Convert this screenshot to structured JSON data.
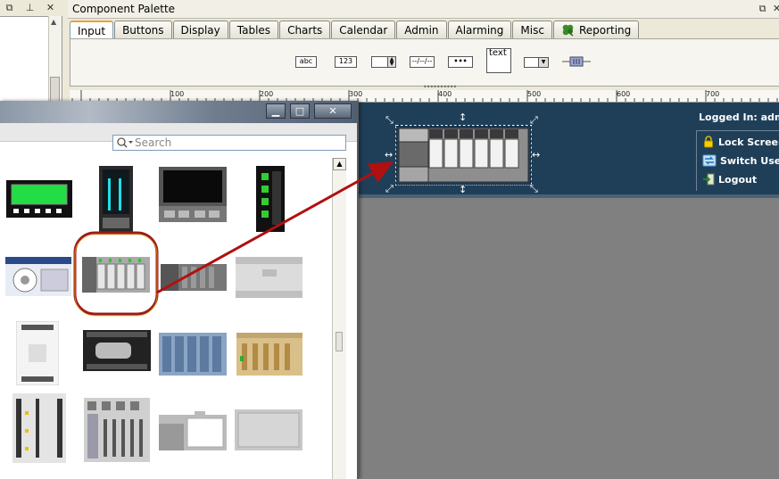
{
  "left_panel": {
    "icons": [
      "restore-icon",
      "pin-icon",
      "close-icon"
    ]
  },
  "palette": {
    "title": "Component Palette",
    "window_controls": [
      "restore-icon",
      "close-icon"
    ],
    "tabs": [
      {
        "label": "Input",
        "active": true
      },
      {
        "label": "Buttons"
      },
      {
        "label": "Display"
      },
      {
        "label": "Tables"
      },
      {
        "label": "Charts"
      },
      {
        "label": "Calendar"
      },
      {
        "label": "Admin"
      },
      {
        "label": "Alarming"
      },
      {
        "label": "Misc"
      },
      {
        "label": "Reporting",
        "icon": "clover-icon"
      }
    ],
    "components": {
      "text_field": "abc",
      "numeric_field": "123",
      "date_field": "--/--/--",
      "password_field": "•••",
      "text_area": "text"
    }
  },
  "ruler": {
    "labels": [
      "100",
      "200",
      "300",
      "400",
      "500",
      "600",
      "700"
    ]
  },
  "banner": {
    "logged_in": "Logged In: admi",
    "menu": [
      {
        "label": "Lock Screen",
        "icon": "lock-icon"
      },
      {
        "label": "Switch User",
        "icon": "switch-user-icon"
      },
      {
        "label": "Logout",
        "icon": "logout-icon"
      }
    ],
    "colors": {
      "banner": "#1f3f59",
      "canvas": "#808080"
    }
  },
  "image_browser": {
    "search_placeholder": "Search",
    "highlight_color": "#9c1c1c",
    "arrow_color": "#b01010"
  }
}
